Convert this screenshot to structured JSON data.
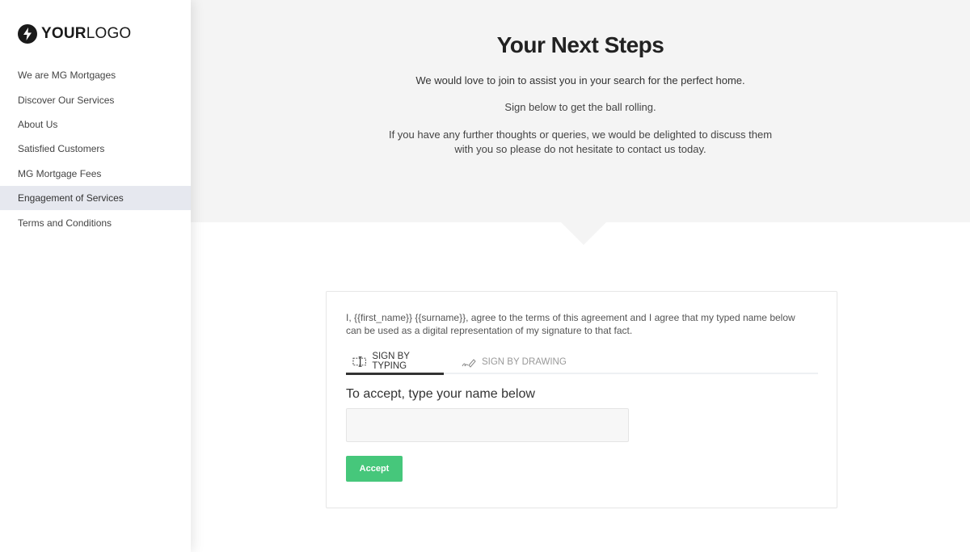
{
  "sidebar": {
    "logo": {
      "icon": "lightning-bolt-icon",
      "bold": "YOUR",
      "light": "LOGO"
    },
    "items": [
      {
        "label": "We are MG Mortgages",
        "active": false
      },
      {
        "label": "Discover Our Services",
        "active": false
      },
      {
        "label": "About Us",
        "active": false
      },
      {
        "label": "Satisfied Customers",
        "active": false
      },
      {
        "label": "MG Mortgage Fees",
        "active": false
      },
      {
        "label": "Engagement of Services",
        "active": true
      },
      {
        "label": "Terms and Conditions",
        "active": false
      }
    ]
  },
  "hero": {
    "title": "Your Next Steps",
    "line1": "We would love to join to assist you in your search for the perfect home.",
    "line2": "Sign below to get the ball rolling.",
    "line3a": "If you have any further thoughts or queries, we would be delighted to discuss them",
    "line3b": "with you so please do not hesitate to contact us today."
  },
  "signature": {
    "agreement_line1": "I, {{first_name}} {{surname}}, agree to the terms of this agreement and I agree that my typed name below",
    "agreement_line2": "can be used as a digital representation of my signature to that fact.",
    "tabs": [
      {
        "label": "SIGN BY TYPING",
        "icon": "text-cursor-icon",
        "active": true
      },
      {
        "label": "SIGN BY DRAWING",
        "icon": "pen-signature-icon",
        "active": false
      }
    ],
    "prompt": "To accept, type your name below",
    "name_value": "",
    "name_placeholder": "",
    "accept_label": "Accept",
    "accent_color": "#46c77b"
  }
}
